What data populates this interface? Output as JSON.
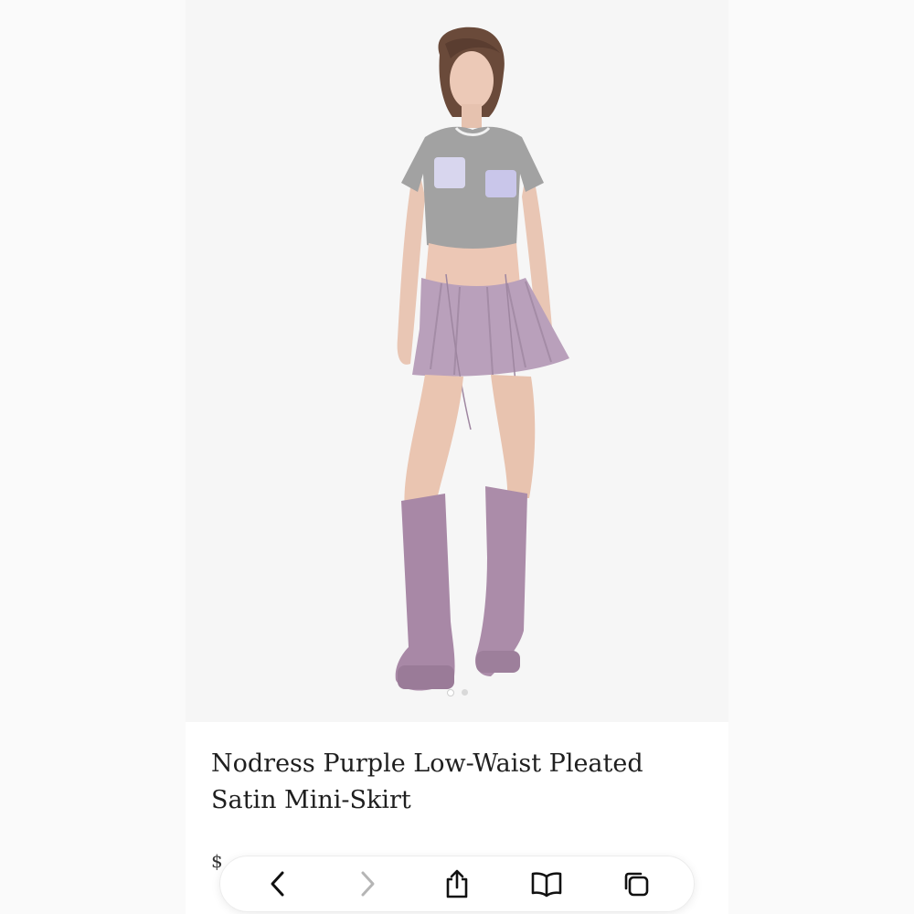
{
  "product": {
    "title": "Nodress Purple Low-Waist Pleated Satin Mini-Skirt",
    "price_partial": "$"
  },
  "gallery": {
    "active_index": 0,
    "count": 2
  },
  "toolbar": {
    "buttons": [
      {
        "icon": "chevron-left-icon",
        "enabled": true
      },
      {
        "icon": "chevron-right-icon",
        "enabled": false
      },
      {
        "icon": "share-icon",
        "enabled": true
      },
      {
        "icon": "bookmarks-icon",
        "enabled": true
      },
      {
        "icon": "tabs-icon",
        "enabled": true
      }
    ]
  },
  "colors": {
    "skirt": "#b9a0bb",
    "boots": "#a888a6",
    "shirt": "#9e9e9e",
    "skin": "#e9c6b4",
    "hair": "#6a4a3a",
    "text": "#1f1f1f",
    "icon_active": "#111111",
    "icon_disabled": "#b5b5b5"
  }
}
